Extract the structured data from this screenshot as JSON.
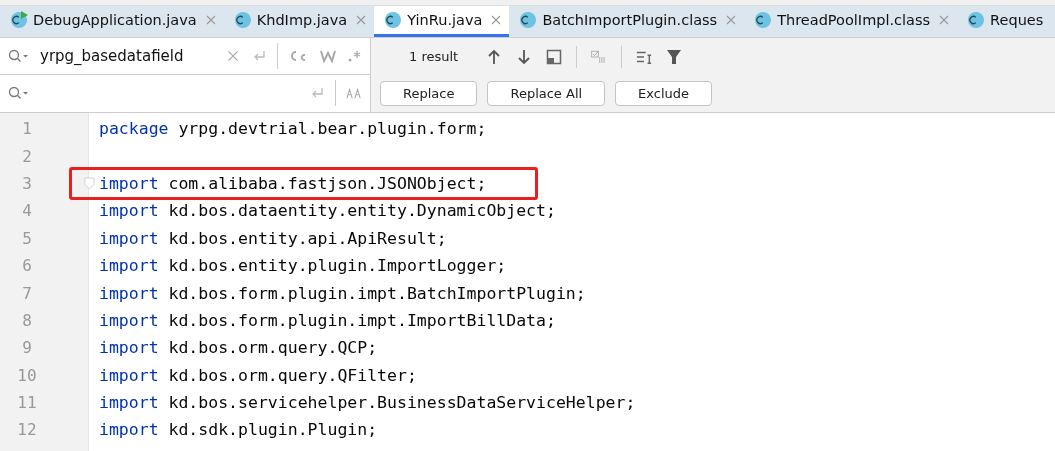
{
  "tabs": [
    {
      "label": "DebugApplication.java",
      "kind": "run",
      "selected": false,
      "closable": true
    },
    {
      "label": "KhdImp.java",
      "kind": "class",
      "selected": false,
      "closable": true
    },
    {
      "label": "YinRu.java",
      "kind": "class",
      "selected": true,
      "closable": true
    },
    {
      "label": "BatchImportPlugin.class",
      "kind": "class",
      "selected": false,
      "closable": true
    },
    {
      "label": "ThreadPoolImpl.class",
      "kind": "class",
      "selected": false,
      "closable": true
    },
    {
      "label": "Reques",
      "kind": "class",
      "selected": false,
      "closable": false
    }
  ],
  "find": {
    "value": "yrpg_basedatafield",
    "result": "1 result"
  },
  "replace": {
    "buttons": [
      "Replace",
      "Replace All",
      "Exclude"
    ]
  },
  "code": [
    {
      "number": "1",
      "keyword": "package",
      "text": "yrpg.devtrial.bear.plugin.form;",
      "highlighted": false,
      "fold": false
    },
    {
      "number": "2",
      "highlighted": false,
      "fold": false
    },
    {
      "number": "3",
      "keyword": "import",
      "text": "com.alibaba.fastjson.JSONObject;",
      "highlighted": true,
      "fold": true
    },
    {
      "number": "4",
      "keyword": "import",
      "text": "kd.bos.dataentity.entity.DynamicObject;",
      "highlighted": false,
      "fold": false
    },
    {
      "number": "5",
      "keyword": "import",
      "text": "kd.bos.entity.api.ApiResult;",
      "highlighted": false,
      "fold": false
    },
    {
      "number": "6",
      "keyword": "import",
      "text": "kd.bos.entity.plugin.ImportLogger;",
      "highlighted": false,
      "fold": false
    },
    {
      "number": "7",
      "keyword": "import",
      "text": "kd.bos.form.plugin.impt.BatchImportPlugin;",
      "highlighted": false,
      "fold": false
    },
    {
      "number": "8",
      "keyword": "import",
      "text": "kd.bos.form.plugin.impt.ImportBillData;",
      "highlighted": false,
      "fold": false
    },
    {
      "number": "9",
      "keyword": "import",
      "text": "kd.bos.orm.query.QCP;",
      "highlighted": false,
      "fold": false
    },
    {
      "number": "10",
      "keyword": "import",
      "text": "kd.bos.orm.query.QFilter;",
      "highlighted": false,
      "fold": false
    },
    {
      "number": "11",
      "keyword": "import",
      "text": "kd.bos.servicehelper.BusinessDataServiceHelper;",
      "highlighted": false,
      "fold": false
    },
    {
      "number": "12",
      "keyword": "import",
      "text": "kd.sdk.plugin.Plugin;",
      "highlighted": false,
      "fold": false
    }
  ]
}
